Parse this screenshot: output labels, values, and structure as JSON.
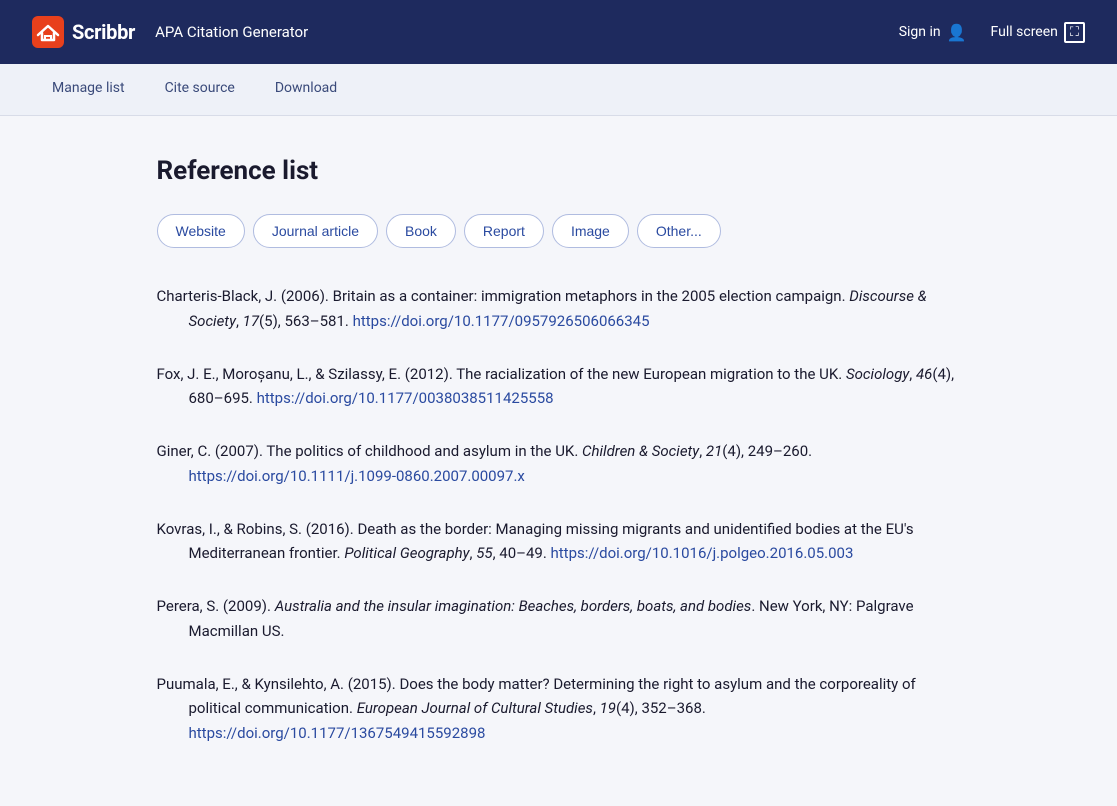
{
  "navbar": {
    "logo_text": "Scribbr",
    "app_title": "APA Citation Generator",
    "sign_in_label": "Sign in",
    "fullscreen_label": "Full screen"
  },
  "tabs": [
    {
      "id": "manage-list",
      "label": "Manage list"
    },
    {
      "id": "cite-source",
      "label": "Cite source"
    },
    {
      "id": "download",
      "label": "Download"
    }
  ],
  "main": {
    "page_title": "Reference list",
    "source_types": [
      "Website",
      "Journal article",
      "Book",
      "Report",
      "Image",
      "Other..."
    ],
    "references": [
      {
        "id": "ref1",
        "text_before_italic": "Charteris-Black, J. (2006). Britain as a container: immigration metaphors in the 2005 election campaign. ",
        "italic_part": "Discourse & Society",
        "text_after_italic": ", ",
        "volume": "17",
        "text_rest": "(5), 563–581. ",
        "doi": "https://doi.org/10.1177/0957926506066345"
      },
      {
        "id": "ref2",
        "text_before_italic": "Fox, J. E., Moroșanu, L., & Szilassy, E. (2012). The racialization of the new European migration to the UK. ",
        "italic_part": "Sociology",
        "text_after_italic": ", ",
        "volume": "46",
        "text_rest": "(4), 680–695. ",
        "doi": "https://doi.org/10.1177/0038038511425558"
      },
      {
        "id": "ref3",
        "text_before_italic": "Giner, C. (2007). The politics of childhood and asylum in the UK. ",
        "italic_part": "Children & Society",
        "text_after_italic": ", ",
        "volume": "21",
        "text_rest": "(4), 249–260. ",
        "doi": "https://doi.org/10.1111/j.1099-0860.2007.00097.x"
      },
      {
        "id": "ref4",
        "text_before_italic": "Kovras, I., & Robins, S. (2016). Death as the border: Managing missing migrants and unidentified bodies at the EU's Mediterranean frontier. ",
        "italic_part": "Political Geography",
        "text_after_italic": ", ",
        "volume": "55",
        "text_rest": ", 40–49. ",
        "doi": "https://doi.org/10.1016/j.polgeo.2016.05.003"
      },
      {
        "id": "ref5",
        "text_before_italic": "Perera, S. (2009). ",
        "italic_part": "Australia and the insular imagination: Beaches, borders, boats, and bodies",
        "text_after_italic": ". New York, NY: Palgrave Macmillan US.",
        "volume": "",
        "text_rest": "",
        "doi": ""
      },
      {
        "id": "ref6",
        "text_before_italic": "Puumala, E., & Kynsilehto, A. (2015). Does the body matter? Determining the right to asylum and the corporeality of political communication. ",
        "italic_part": "European Journal of Cultural Studies",
        "text_after_italic": ", ",
        "volume": "19",
        "text_rest": "(4), 352–368. ",
        "doi": "https://doi.org/10.1177/1367549415592898"
      }
    ]
  }
}
